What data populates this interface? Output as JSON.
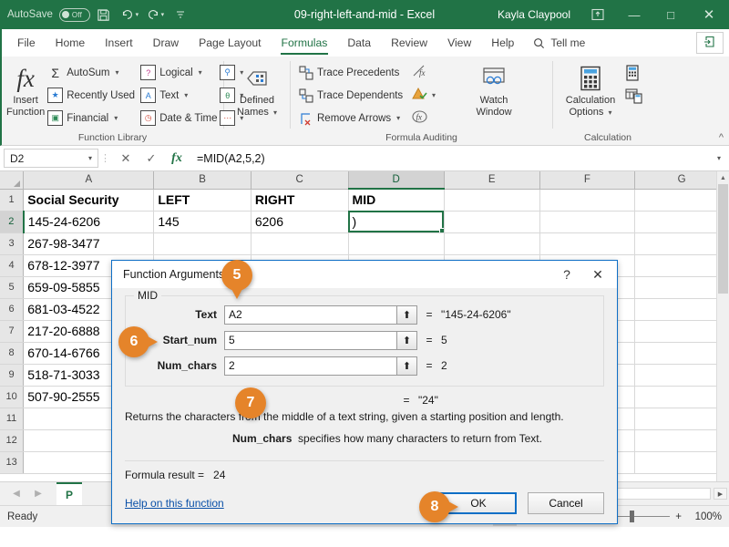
{
  "titlebar": {
    "autosave_label": "AutoSave",
    "autosave_state": "Off",
    "save_icon": "save-icon",
    "undo_icon": "undo-icon",
    "redo_icon": "redo-icon",
    "customize_icon": "customize-quick-access-icon",
    "document_title": "09-right-left-and-mid  -  Excel",
    "user_name": "Kayla Claypool",
    "ribbon_display_icon": "ribbon-display-options-icon",
    "minimize": "—",
    "maximize": "□",
    "close": "✕",
    "background_color": "#217346"
  },
  "tabs": {
    "items": [
      {
        "label": "File",
        "active": false
      },
      {
        "label": "Home",
        "active": false
      },
      {
        "label": "Insert",
        "active": false
      },
      {
        "label": "Draw",
        "active": false
      },
      {
        "label": "Page Layout",
        "active": false
      },
      {
        "label": "Formulas",
        "active": true
      },
      {
        "label": "Data",
        "active": false
      },
      {
        "label": "Review",
        "active": false
      },
      {
        "label": "View",
        "active": false
      },
      {
        "label": "Help",
        "active": false
      }
    ],
    "tell_me": "Tell me",
    "tell_me_icon": "search-icon",
    "share_icon": "share-icon",
    "accent_color": "#217346"
  },
  "ribbon": {
    "groups": [
      {
        "title": "Function Library",
        "big_button": {
          "label_line1": "Insert",
          "label_line2": "Function",
          "icon": "fx-icon"
        },
        "small_buttons": [
          {
            "label": "AutoSum",
            "icon": "autosum-sigma-icon",
            "has_caret": true
          },
          {
            "label": "Recently Used",
            "icon": "recently-used-icon",
            "has_caret": true
          },
          {
            "label": "Financial",
            "icon": "financial-icon",
            "has_caret": true
          },
          {
            "label": "Logical",
            "icon": "logical-icon",
            "has_caret": true
          },
          {
            "label": "Text",
            "icon": "text-icon",
            "has_caret": true
          },
          {
            "label": "Date & Time",
            "icon": "date-time-icon",
            "has_caret": true
          }
        ],
        "icon_only_buttons": [
          {
            "icon": "lookup-reference-icon",
            "has_caret": true
          },
          {
            "icon": "math-trig-icon",
            "has_caret": true
          },
          {
            "icon": "more-functions-icon",
            "has_caret": true
          }
        ]
      },
      {
        "title": "",
        "big_button": {
          "label_line1": "Defined",
          "label_line2": "Names",
          "icon": "defined-names-icon",
          "has_caret": true
        }
      },
      {
        "title": "Formula Auditing",
        "small_buttons": [
          {
            "label": "Trace Precedents",
            "icon": "trace-precedents-icon"
          },
          {
            "label": "Trace Dependents",
            "icon": "trace-dependents-icon"
          },
          {
            "label": "Remove Arrows",
            "icon": "remove-arrows-icon",
            "has_caret": true
          }
        ],
        "icon_only_buttons": [
          {
            "icon": "show-formulas-icon"
          },
          {
            "icon": "error-checking-icon",
            "has_caret": true
          },
          {
            "icon": "evaluate-formula-icon"
          }
        ],
        "watch_window": {
          "label_line1": "Watch",
          "label_line2": "Window",
          "icon": "watch-window-icon"
        }
      },
      {
        "title": "Calculation",
        "big_button": {
          "label_line1": "Calculation",
          "label_line2": "Options",
          "icon": "calculation-options-icon",
          "has_caret": true
        },
        "icon_only_buttons": [
          {
            "icon": "calculate-now-icon"
          },
          {
            "icon": "calculate-sheet-icon"
          }
        ]
      }
    ],
    "collapse_icon": "collapse-ribbon-icon"
  },
  "formula_bar": {
    "name_box_value": "D2",
    "cancel_icon": "cancel-icon",
    "enter_icon": "enter-icon",
    "insert_function_icon": "fx-icon",
    "formula_value": "=MID(A2,5,2)",
    "expand_icon": "expand-formula-bar-icon"
  },
  "grid": {
    "columns": [
      "A",
      "B",
      "C",
      "D",
      "E",
      "F",
      "G"
    ],
    "selected_column": "D",
    "selected_row": "2",
    "active_cell": "D2",
    "rows": [
      {
        "num": "1",
        "cells": [
          "Social Security",
          "LEFT",
          "RIGHT",
          "MID",
          "",
          "",
          ""
        ],
        "bold": true
      },
      {
        "num": "2",
        "cells": [
          "145-24-6206",
          "145",
          "6206",
          ")",
          "",
          "",
          ""
        ],
        "bold": false
      },
      {
        "num": "3",
        "cells": [
          "267-98-3477",
          "",
          "",
          "",
          "",
          "",
          ""
        ],
        "bold": false
      },
      {
        "num": "4",
        "cells": [
          "678-12-3977",
          "",
          "",
          "",
          "",
          "",
          ""
        ],
        "bold": false
      },
      {
        "num": "5",
        "cells": [
          "659-09-5855",
          "",
          "",
          "",
          "",
          "",
          ""
        ],
        "bold": false
      },
      {
        "num": "6",
        "cells": [
          "681-03-4522",
          "",
          "",
          "",
          "",
          "",
          ""
        ],
        "bold": false
      },
      {
        "num": "7",
        "cells": [
          "217-20-6888",
          "",
          "",
          "",
          "",
          "",
          ""
        ],
        "bold": false
      },
      {
        "num": "8",
        "cells": [
          "670-14-6766",
          "",
          "",
          "",
          "",
          "",
          ""
        ],
        "bold": false
      },
      {
        "num": "9",
        "cells": [
          "518-71-3033",
          "",
          "",
          "",
          "",
          "",
          ""
        ],
        "bold": false
      },
      {
        "num": "10",
        "cells": [
          "507-90-2555",
          "",
          "",
          "",
          "",
          "",
          ""
        ],
        "bold": false
      },
      {
        "num": "11",
        "cells": [
          "",
          "",
          "",
          "",
          "",
          "",
          ""
        ],
        "bold": false
      },
      {
        "num": "12",
        "cells": [
          "",
          "",
          "",
          "",
          "",
          "",
          ""
        ],
        "bold": false
      },
      {
        "num": "13",
        "cells": [
          "",
          "",
          "",
          "",
          "",
          "",
          ""
        ],
        "bold": false
      }
    ],
    "scroll_up_icon": "scroll-up-arrow-icon",
    "scroll_down_icon": "scroll-down-arrow-icon"
  },
  "sheet_bar": {
    "prev_icon": "previous-sheet-icon",
    "next_icon": "next-sheet-icon",
    "active_sheet": "P",
    "scroll_right_icon": "scroll-right-arrow-icon"
  },
  "status_bar": {
    "status_text": "Ready",
    "view_buttons": [
      {
        "icon": "normal-view-icon",
        "active": true
      },
      {
        "icon": "page-layout-view-icon",
        "active": false
      },
      {
        "icon": "page-break-preview-icon",
        "active": false
      }
    ],
    "zoom_out": "−",
    "zoom_in": "+",
    "zoom_level": "100%"
  },
  "dialog": {
    "title": "Function Arguments",
    "help_icon": "help-question-icon",
    "close_icon": "close-icon",
    "function_name": "MID",
    "arguments": [
      {
        "label": "Text",
        "value": "A2",
        "result": "\"145-24-6206\"",
        "collapse_icon": "collapse-dialog-icon"
      },
      {
        "label": "Start_num",
        "value": "5",
        "result": "5",
        "collapse_icon": "collapse-dialog-icon"
      },
      {
        "label": "Num_chars",
        "value": "2",
        "result": "2",
        "collapse_icon": "collapse-dialog-icon"
      }
    ],
    "preview_equals": "=",
    "preview_result": "\"24\"",
    "description": "Returns the characters from the middle of a text string, given a starting position and length.",
    "arg_help_bold": "Num_chars",
    "arg_help_text": "specifies how many characters to return from Text.",
    "formula_result_label": "Formula result =",
    "formula_result_value": "24",
    "help_link": "Help on this function",
    "ok_label": "OK",
    "cancel_label": "Cancel"
  },
  "callouts": [
    {
      "number": "5"
    },
    {
      "number": "6"
    },
    {
      "number": "7"
    },
    {
      "number": "8"
    }
  ]
}
